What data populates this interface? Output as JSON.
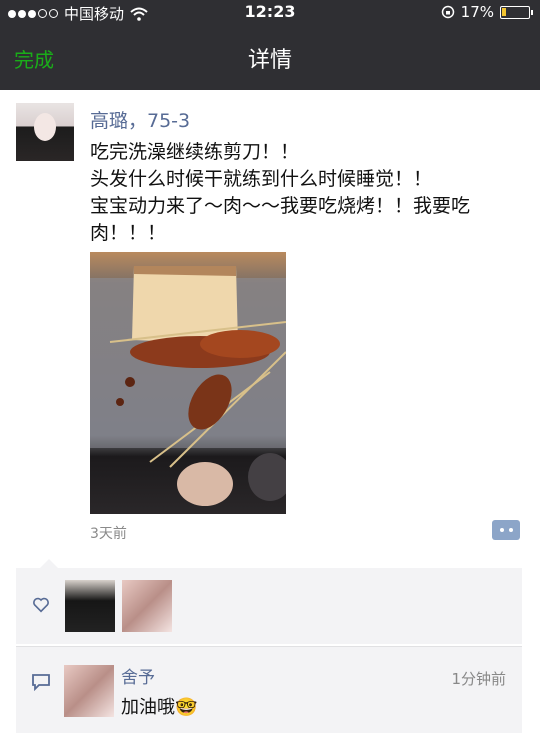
{
  "status_bar": {
    "carrier": "中国移动",
    "time": "12:23",
    "battery": "17%",
    "battery_level": 0.17
  },
  "nav": {
    "done_label": "完成",
    "title": "详情"
  },
  "post": {
    "author": "高璐，75-3",
    "text": "吃完洗澡继续练剪刀！！\n头发什么时候干就练到什么时候睡觉！！\n宝宝动力来了～肉～～我要吃烧烤！！我要吃肉！！！",
    "time": "3天前"
  },
  "comment": {
    "author": "舍予",
    "time": "1分钟前",
    "text": "加油哦🤓"
  },
  "colors": {
    "accent_green": "#1aad19",
    "link_blue": "#576b95",
    "bar_bg": "#2f2f33"
  }
}
